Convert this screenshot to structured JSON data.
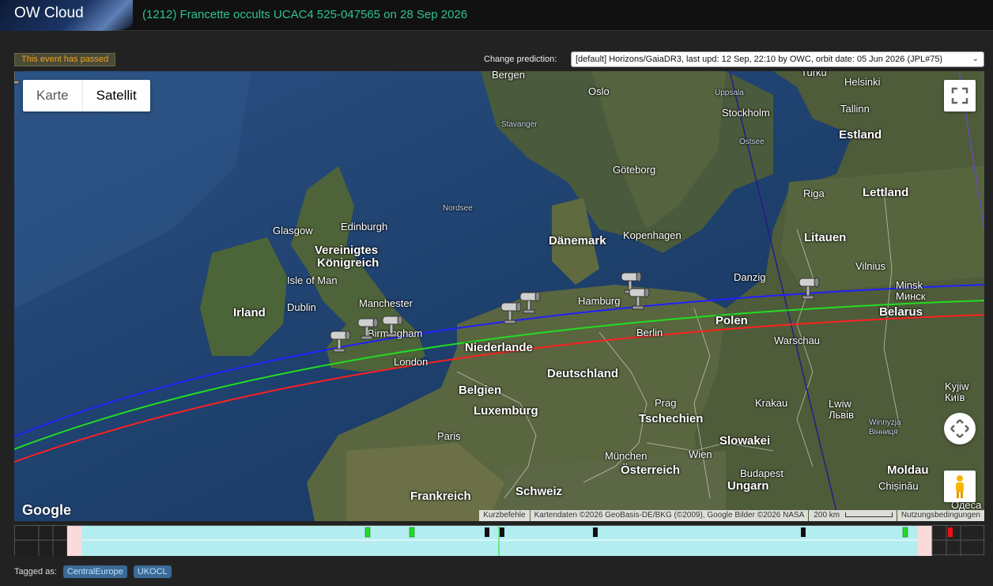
{
  "header": {
    "logo_text": "OW Cloud",
    "event_title": "(1212) Francette occults UCAC4 525-047565 on 28 Sep 2026"
  },
  "status": {
    "passed_badge": "This event has passed"
  },
  "prediction": {
    "label": "Change prediction:",
    "selected": "[default] Horizons/GaiaDR3, last upd: 12 Sep, 22:10 by OWC, orbit date: 05 Jun 2026 (JPL#75)"
  },
  "map": {
    "type_buttons": [
      "Karte",
      "Satellit"
    ],
    "active_type": "Satellit",
    "google_logo": "Google",
    "attribution": {
      "shortcuts": "Kurzbefehle",
      "data": "Kartendaten ©2026 GeoBasis-DE/BKG (©2009), Google Bilder ©2026 NASA",
      "scale": "200 km",
      "terms": "Nutzungsbedingungen"
    },
    "icons": {
      "fullscreen": "fullscreen-icon",
      "pan": "pan-icon",
      "pegman": "pegman-icon",
      "observer": "telescope-icon"
    },
    "colors": {
      "north_limit": "#2020ff",
      "center_line": "#22dd22",
      "south_limit": "#ff2020"
    },
    "labels": {
      "bergen": "Bergen",
      "oslo": "Oslo",
      "stavanger": "Stavanger",
      "turku": "Turku",
      "helsinki": "Helsinki",
      "uppsala": "Uppsala",
      "stockholm": "Stockholm",
      "tallinn": "Tallinn",
      "ostsee": "Ostsee",
      "estland": "Estland",
      "goteborg": "Göteborg",
      "riga": "Riga",
      "lettland": "Lettland",
      "nordsee": "Nordsee",
      "glasgow": "Glasgow",
      "edinburgh": "Edinburgh",
      "danemark": "Dänemark",
      "kopenhagen": "Kopenhagen",
      "litauen": "Litauen",
      "vereinigtes": "Vereinigtes",
      "konigreich": "Königreich",
      "vilnius": "Vilnius",
      "isle_of_man": "Isle of Man",
      "danzig": "Danzig",
      "minsk": "Minsk",
      "minsk_cyr": "Минск",
      "dublin": "Dublin",
      "irland": "Irland",
      "manchester": "Manchester",
      "hamburg": "Hamburg",
      "belarus": "Belarus",
      "birmingham": "Birmingham",
      "berlin": "Berlin",
      "polen": "Polen",
      "niederlande": "Niederlande",
      "warschau": "Warschau",
      "london": "London",
      "deutschland": "Deutschland",
      "belgien": "Belgien",
      "kyjiw": "Kyjiw",
      "kyjiw_cyr": "Київ",
      "prag": "Prag",
      "krakau": "Krakau",
      "lwiw": "Lwiw",
      "lwiw_cyr": "Львів",
      "luxemburg": "Luxemburg",
      "tschechien": "Tschechien",
      "winnyzja": "Winnyzja",
      "winnyzja_cyr": "Вінниця",
      "paris": "Paris",
      "slowakei": "Slowakei",
      "munchen": "München",
      "wien": "Wien",
      "osterreich": "Österreich",
      "budapest": "Budapest",
      "moldau": "Moldau",
      "ungarn": "Ungarn",
      "frankreich": "Frankreich",
      "schweiz": "Schweiz",
      "chisinau": "Chișinău",
      "odesa": "Одеса"
    }
  },
  "tags": {
    "label": "Tagged as:",
    "items": [
      "CentralEurope",
      "UKOCL"
    ]
  }
}
